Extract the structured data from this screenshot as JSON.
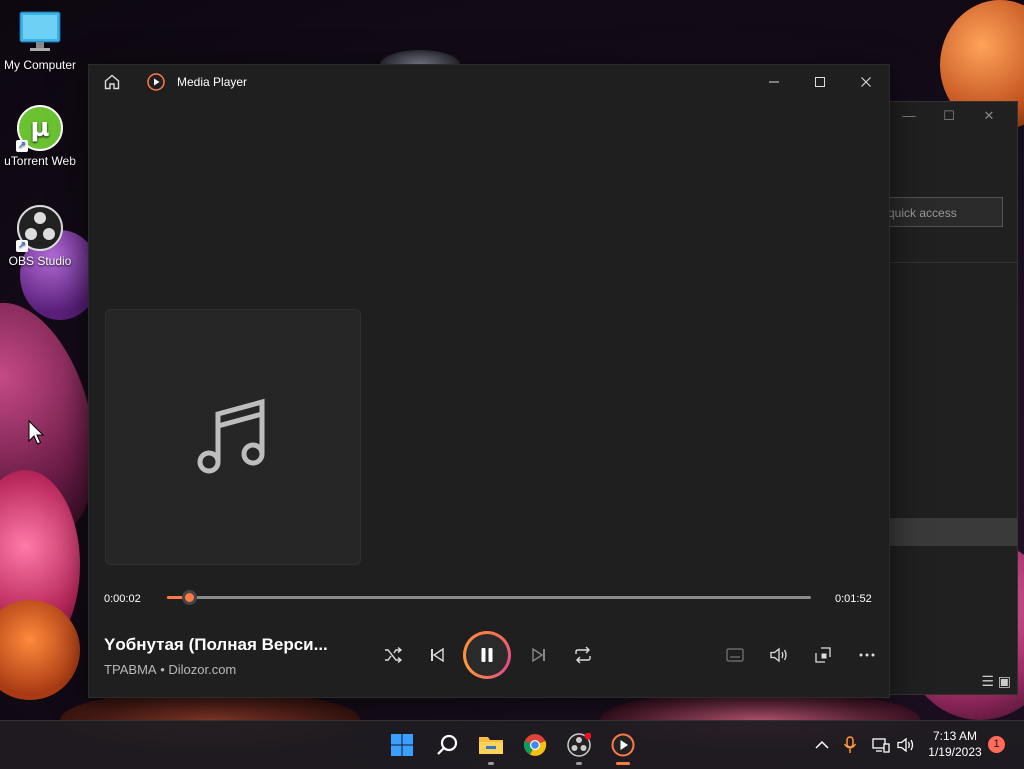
{
  "desktop": {
    "icons": [
      {
        "label": "My Computer"
      },
      {
        "label": "uTorrent Web"
      },
      {
        "label": "OBS Studio"
      }
    ]
  },
  "background_window": {
    "search_placeholder": "quick access"
  },
  "player": {
    "title": "Media Player",
    "track": {
      "title": "Yобнутая (Полная Верси...",
      "artist": "ТРАВМА • Dilozor.com"
    },
    "time_elapsed": "0:00:02",
    "time_total": "0:01:52",
    "progress_fraction": 0.018,
    "accent_color": "#ff7a45"
  },
  "taskbar": {
    "icons": [
      "windows-start-icon",
      "search-icon",
      "file-explorer-icon",
      "chrome-icon",
      "obs-studio-icon",
      "media-player-icon"
    ],
    "clock_time": "7:13 AM",
    "clock_date": "1/19/2023",
    "notification_count": "1"
  }
}
